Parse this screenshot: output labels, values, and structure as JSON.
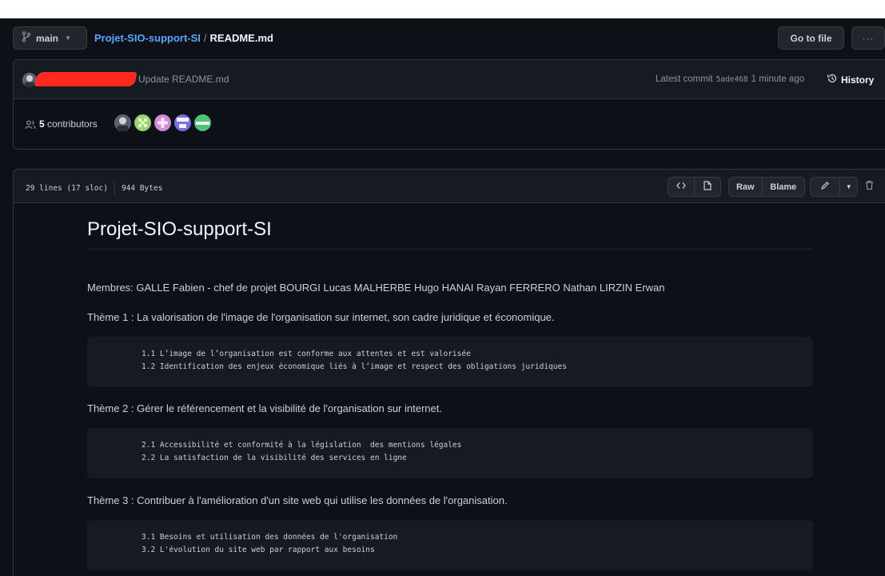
{
  "topbar": {
    "branch": "main",
    "repo": "Projet-SIO-support-SI",
    "separator": "/",
    "file": "README.md",
    "goto_label": "Go to file",
    "more_label": "···"
  },
  "commit": {
    "message": "Update README.md",
    "latest_label": "Latest commit",
    "sha": "5ade468",
    "time": "1 minute ago",
    "history_label": "History"
  },
  "contributors": {
    "count": "5",
    "label": "contributors"
  },
  "file_header": {
    "lines": "29 lines (17 sloc)",
    "size": "944 Bytes",
    "raw_label": "Raw",
    "blame_label": "Blame"
  },
  "readme": {
    "title": "Projet-SIO-support-SI",
    "members": "Membres: GALLE Fabien - chef de projet BOURGI Lucas MALHERBE Hugo HANAI Rayan FERRERO Nathan LIRZIN Erwan",
    "theme1": "Thème 1 : La valorisation de l'image de l'organisation sur internet, son cadre juridique et économique.",
    "code1_l1": "1.1 L’image de l’organisation est conforme aux attentes et est valorisée",
    "code1_l2": "1.2 Identification des enjeux économique liés à l’image et respect des obligations juridiques",
    "theme2": "Thème 2 : Gérer le référencement et la visibilité de l'organisation sur internet.",
    "code2_l1": "2.1 Accessibilité et conformité à la législation  des mentions légales",
    "code2_l2": "2.2 La satisfaction de la visibilité des services en ligne",
    "theme3": "Thème 3 : Contribuer à l'amélioration d'un site web qui utilise les données de l'organisation.",
    "code3_l1": "3.1 Besoins et utilisation des données de l'organisation",
    "code3_l2": "3.2 L'évolution du site web par rapport aux besoins"
  },
  "colors": {
    "background": "#0d1117",
    "link": "#58a6ff",
    "redaction": "#ff2a1f"
  },
  "icons": [
    "branch-icon",
    "history-icon",
    "people-icon",
    "code-icon",
    "file-icon",
    "pencil-icon",
    "trash-icon"
  ]
}
